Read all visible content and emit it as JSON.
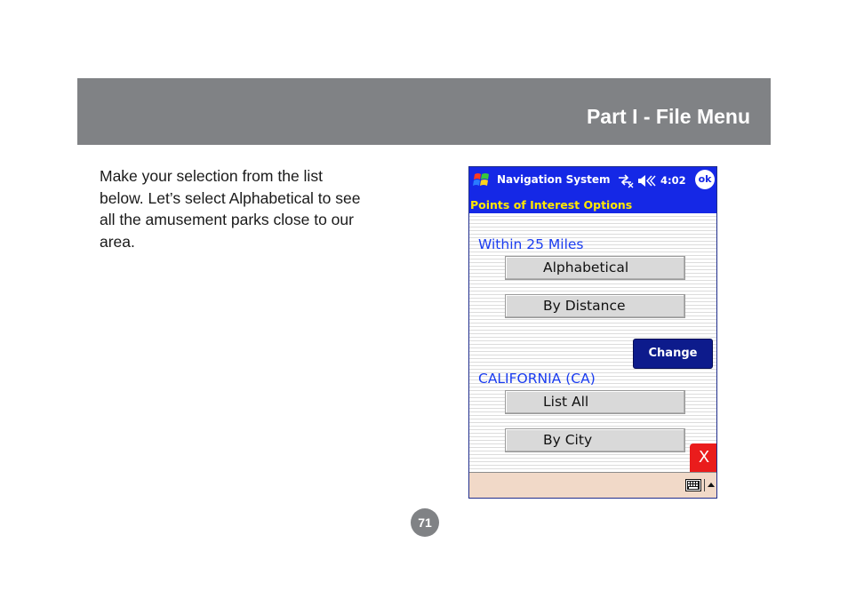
{
  "header": {
    "title": "Part I - File Menu"
  },
  "body": {
    "lines": [
      "Make your selection from the list",
      "below.  Let’s select Alphabetical to see",
      "all the amusement parks close to our",
      "area."
    ]
  },
  "pda": {
    "app_title": "Navigation System",
    "time": "4:02",
    "ok_label": "ok",
    "subtitle": "Points of Interest Options",
    "section1_label": "Within 25 Miles",
    "button_alphabetical": "Alphabetical",
    "button_by_distance": "By Distance",
    "change_label": "Change",
    "section2_label": "CALIFORNIA (CA)",
    "button_list_all": "List All",
    "button_by_city": "By City",
    "close_label": "X"
  },
  "page_number": "71",
  "colors": {
    "header_band": "#808285",
    "pda_title_bar": "#1528e6",
    "subtitle_text": "#ffe800",
    "section_label": "#1a3cf0",
    "change_button": "#0d1b8c",
    "close_button": "#ea1c1c",
    "input_panel": "#f1d9c8"
  }
}
